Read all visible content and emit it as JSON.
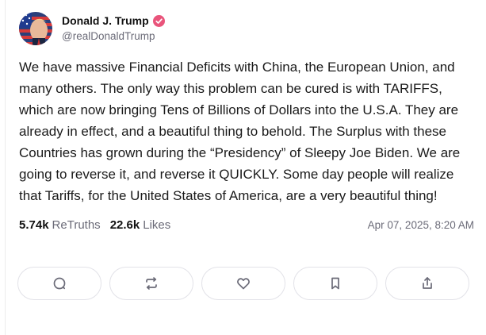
{
  "author": {
    "display_name": "Donald J. Trump",
    "handle": "@realDonaldTrump",
    "verified": true,
    "verified_color": "#e9547b"
  },
  "post": {
    "text": "We have massive Financial Deficits with China, the European Union, and many others. The only way this problem can be cured is with TARIFFS, which are now bringing Tens of Billions of Dollars into the U.S.A. They are already in effect, and a beautiful thing to behold. The Surplus with these Countries has grown during the “Presidency” of Sleepy Joe Biden. We are going to reverse it, and reverse it QUICKLY. Some day people will realize that Tariffs, for the United States of America, are a very beautiful thing!"
  },
  "stats": {
    "retruths_value": "5.74k",
    "retruths_label": "ReTruths",
    "likes_value": "22.6k",
    "likes_label": "Likes",
    "timestamp": "Apr 07, 2025, 8:20 AM"
  },
  "actions": [
    {
      "icon": "comment-icon"
    },
    {
      "icon": "retruth-icon"
    },
    {
      "icon": "heart-icon"
    },
    {
      "icon": "bookmark-icon"
    },
    {
      "icon": "share-icon"
    }
  ],
  "colors": {
    "icon": "#6b6b78",
    "border": "#e2e2e8",
    "muted_text": "#6b6b78"
  }
}
